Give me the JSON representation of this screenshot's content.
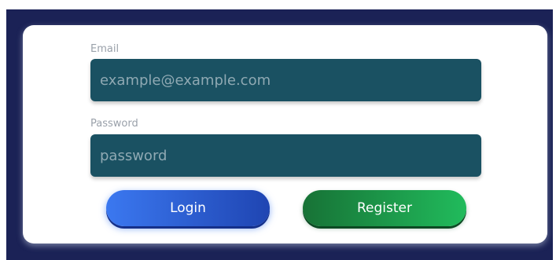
{
  "login_form": {
    "email": {
      "label": "Email",
      "placeholder": "example@example.com",
      "value": ""
    },
    "password": {
      "label": "Password",
      "placeholder": "password",
      "value": ""
    },
    "login_button_label": "Login",
    "register_button_label": "Register"
  },
  "colors": {
    "page_background": "#1b2256",
    "card_background": "#ffffff",
    "field_background": "#1a5162",
    "login_button_start": "#3b78f0",
    "login_button_end": "#1f45b2",
    "register_button_start": "#177236",
    "register_button_end": "#21bb5c"
  }
}
